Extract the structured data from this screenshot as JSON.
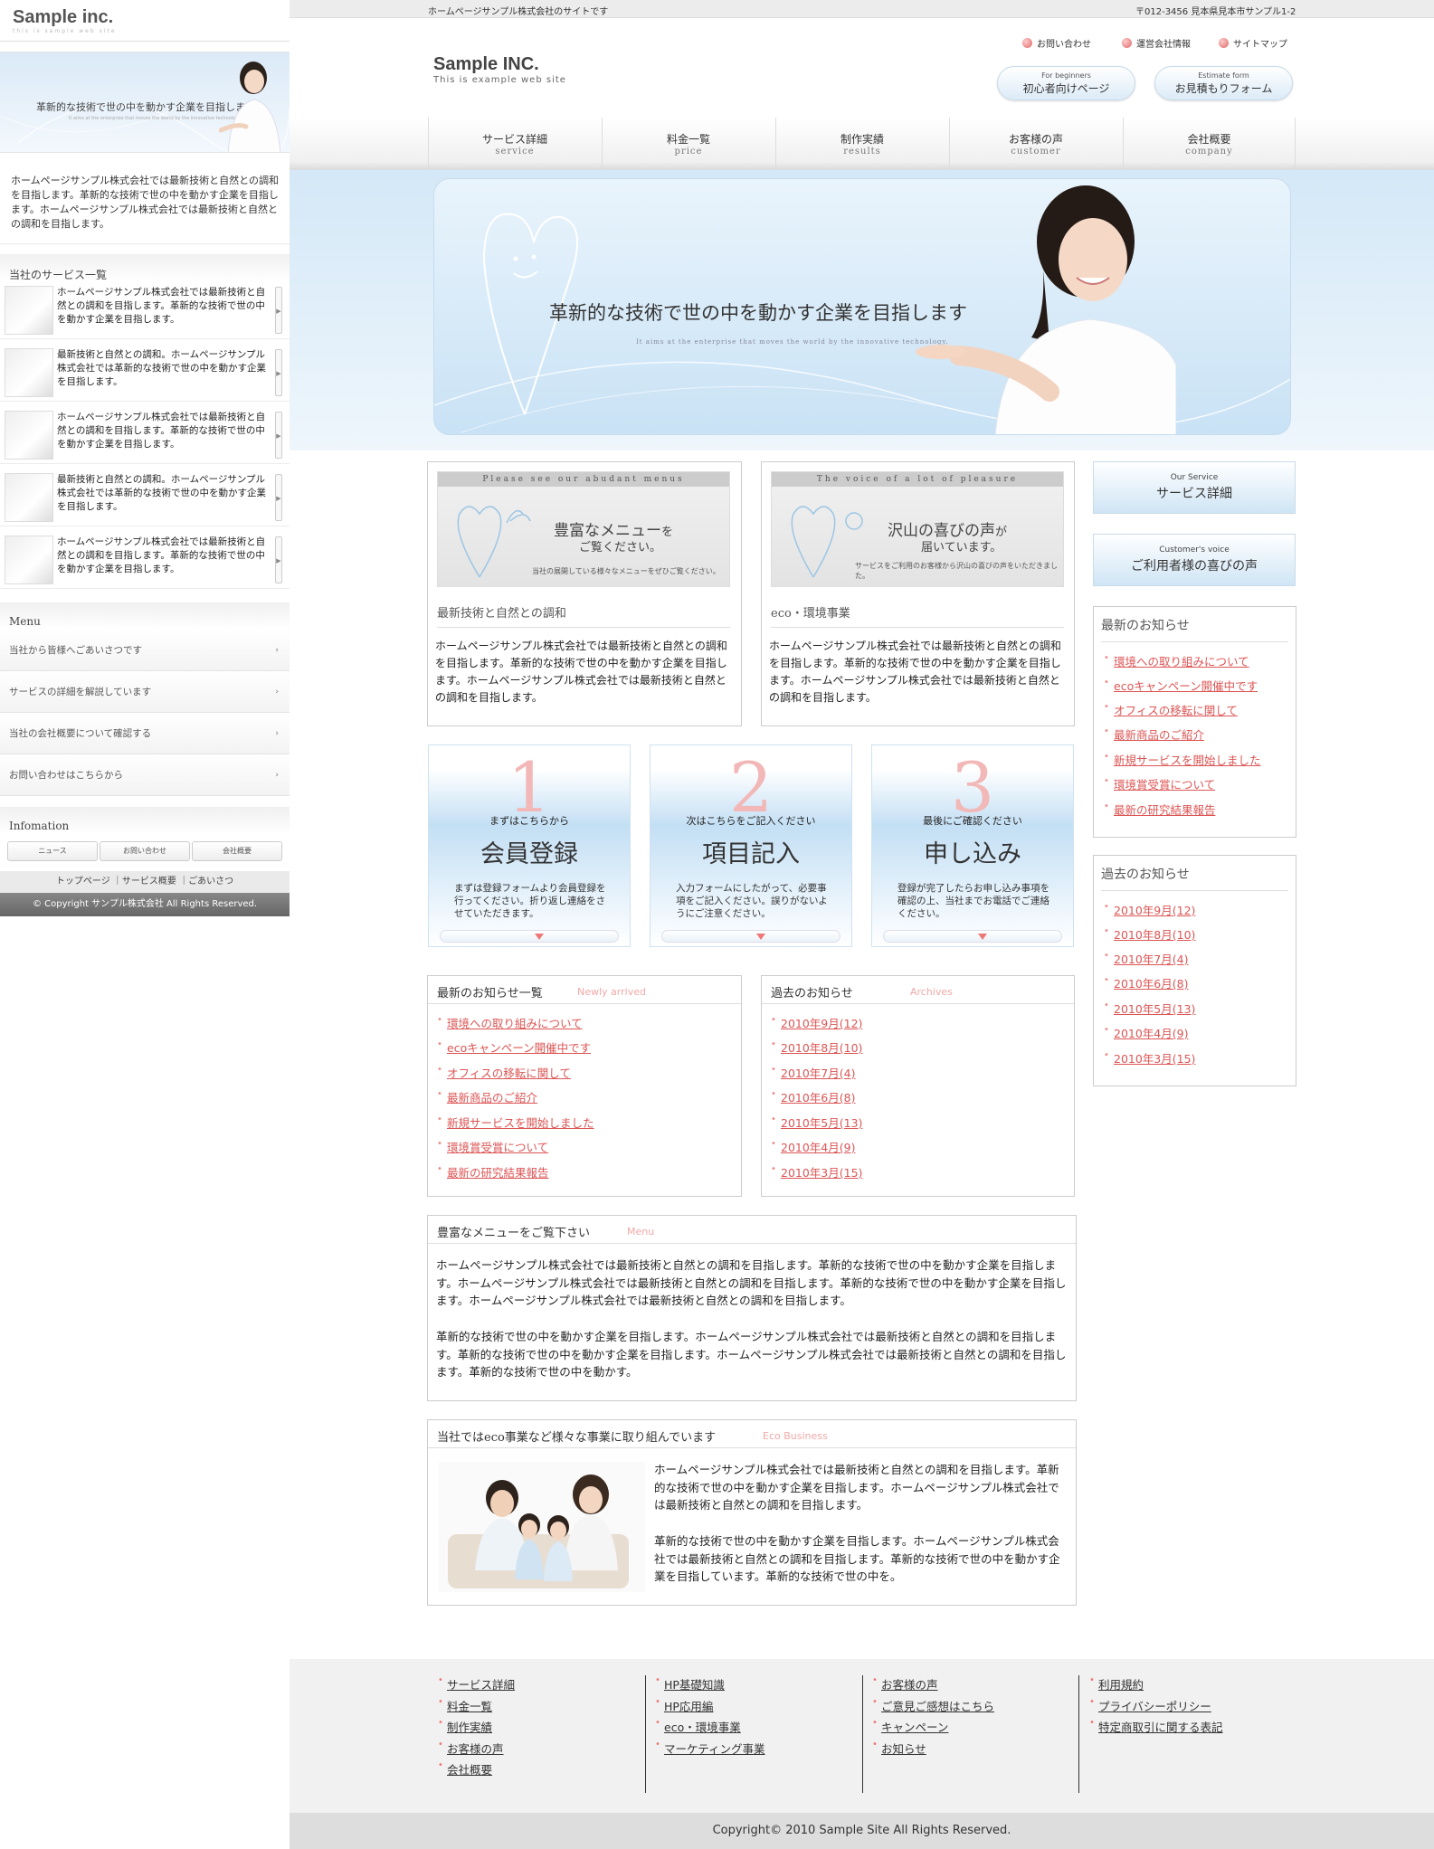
{
  "sidebar": {
    "logo": "Sample inc.",
    "logo_sub": "this is sample web site",
    "banner_text": "革新的な技術で世の中を動かす企業を目指します",
    "banner_sub": "It aims at the enterprise that moves the world by the innovative technology.",
    "intro": "ホームページサンプル株式会社では最新技術と自然との調和を目指します。革新的な技術で世の中を動かす企業を目指します。ホームページサンプル株式会社では最新技術と自然との調和を目指します。",
    "services_heading": "当社のサービス一覧",
    "services": [
      {
        "text": "ホームページサンプル株式会社では最新技術と自然との調和を目指します。革新的な技術で世の中を動かす企業を目指します。"
      },
      {
        "text": "最新技術と自然との調和。ホームページサンプル株式会社では革新的な技術で世の中を動かす企業を目指します。"
      },
      {
        "text": "ホームページサンプル株式会社では最新技術と自然との調和を目指します。革新的な技術で世の中を動かす企業を目指します。"
      },
      {
        "text": "最新技術と自然との調和。ホームページサンプル株式会社では革新的な技術で世の中を動かす企業を目指します。"
      },
      {
        "text": "ホームページサンプル株式会社では最新技術と自然との調和を目指します。革新的な技術で世の中を動かす企業を目指します。"
      }
    ],
    "menu_heading": "Menu",
    "menu": [
      "当社から皆様へごあいさつです",
      "サービスの詳細を解説しています",
      "当社の会社概要について確認する",
      "お問い合わせはこちらから"
    ],
    "info_heading": "Infomation",
    "info_buttons": [
      "ニュース",
      "お問い合わせ",
      "会社概要"
    ],
    "footer_links": "トップページ ｜サービス概要 ｜ごあいさつ",
    "copyright": "© Copyright サンプル株式会社 All Rights Reserved."
  },
  "topbar": {
    "tagline": "ホームページサンプル株式会社のサイトです",
    "address": "〒012-3456 見本県見本市サンプル1-2"
  },
  "header": {
    "logo": "Sample INC.",
    "logo_sub": "This is example web site",
    "util_links": [
      "お問い合わせ",
      "運営会社情報",
      "サイトマップ"
    ],
    "pill1": {
      "small": "For beginners",
      "label": "初心者向けページ"
    },
    "pill2": {
      "small": "Estimate form",
      "label": "お見積もりフォーム"
    }
  },
  "nav": [
    {
      "ja": "サービス詳細",
      "en": "service"
    },
    {
      "ja": "料金一覧",
      "en": "price"
    },
    {
      "ja": "制作実績",
      "en": "results"
    },
    {
      "ja": "お客様の声",
      "en": "customer"
    },
    {
      "ja": "会社概要",
      "en": "company"
    }
  ],
  "hero": {
    "headline": "革新的な技術で世の中を動かす企業を目指します",
    "sub": "It aims at the enterprise that moves the world by the innovative technology."
  },
  "features": [
    {
      "caption": "Please see our abudant menus",
      "big1": "豊富なメニュー",
      "big1s": "を",
      "big2": "ご覧ください。",
      "small": "当社の展開している様々なメニューをぜひご覧ください。",
      "title": "最新技術と自然との調和",
      "body": "ホームページサンプル株式会社では最新技術と自然との調和を目指します。革新的な技術で世の中を動かす企業を目指します。ホームページサンプル株式会社では最新技術と自然との調和を目指します。"
    },
    {
      "caption": "The voice of a lot of pleasure",
      "big1": "沢山の喜びの声",
      "big1s": "が",
      "big2": "届いています。",
      "small": "サービスをご利用のお客様から沢山の喜びの声をいただきました。",
      "title": "eco・環境事業",
      "body": "ホームページサンプル株式会社では最新技術と自然との調和を目指します。革新的な技術で世の中を動かす企業を目指します。ホームページサンプル株式会社では最新技術と自然との調和を目指します。"
    }
  ],
  "side_buttons": [
    {
      "small": "Our Service",
      "label": "サービス詳細"
    },
    {
      "small": "Customer's voice",
      "label": "ご利用者様の喜びの声"
    }
  ],
  "side_news_title": "最新のお知らせ",
  "side_archive_title": "過去のお知らせ",
  "news": [
    "環境への取り組みについて",
    "ecoキャンペーン開催中です",
    "オフィスの移転に関して",
    "最新商品のご紹介",
    "新規サービスを開始しました",
    "環境賞受賞について",
    "最新の研究結果報告"
  ],
  "archives": [
    "2010年9月(12)",
    "2010年8月(10)",
    "2010年7月(4)",
    "2010年6月(8)",
    "2010年5月(13)",
    "2010年4月(9)",
    "2010年3月(15)"
  ],
  "steps": [
    {
      "num": "1",
      "label": "まずはこちらから",
      "title": "会員登録",
      "desc": "まずは登録フォームより会員登録を行ってください。折り返し連絡をさせていただきます。"
    },
    {
      "num": "2",
      "label": "次はこちらをご記入ください",
      "title": "項目記入",
      "desc": "入力フォームにしたがって、必要事項をご記入ください。誤りがないようにご注意ください。"
    },
    {
      "num": "3",
      "label": "最後にご確認ください",
      "title": "申し込み",
      "desc": "登録が完了したらお申し込み事項を確認の上、当社までお電話でご連絡ください。"
    }
  ],
  "news_box": {
    "title": "最新のお知らせ一覧",
    "sub": "Newly arrived"
  },
  "archive_box": {
    "title": "過去のお知らせ",
    "sub": "Archives"
  },
  "menu_box": {
    "title": "豊富なメニューをご覧下さい",
    "sub": "Menu",
    "p1": "ホームページサンプル株式会社では最新技術と自然との調和を目指します。革新的な技術で世の中を動かす企業を目指します。ホームページサンプル株式会社では最新技術と自然との調和を目指します。革新的な技術で世の中を動かす企業を目指します。ホームページサンプル株式会社では最新技術と自然との調和を目指します。",
    "p2": "革新的な技術で世の中を動かす企業を目指します。ホームページサンプル株式会社では最新技術と自然との調和を目指します。革新的な技術で世の中を動かす企業を目指します。ホームページサンプル株式会社では最新技術と自然との調和を目指します。革新的な技術で世の中を動かす。"
  },
  "eco_box": {
    "title": "当社ではeco事業など様々な事業に取り組んでいます",
    "sub": "Eco Business",
    "p1": "ホームページサンプル株式会社では最新技術と自然との調和を目指します。革新的な技術で世の中を動かす企業を目指します。ホームページサンプル株式会社では最新技術と自然との調和を目指します。",
    "p2": "革新的な技術で世の中を動かす企業を目指します。ホームページサンプル株式会社では最新技術と自然との調和を目指します。革新的な技術で世の中を動かす企業を目指しています。革新的な技術で世の中を。"
  },
  "footer": {
    "col1": [
      "サービス詳細",
      "料金一覧",
      "制作実績",
      "お客様の声",
      "会社概要"
    ],
    "col2": [
      "HP基礎知識",
      "HP応用編",
      "eco・環境事業",
      "マーケティング事業"
    ],
    "col3": [
      "お客様の声",
      "ご意見ご感想はこちら",
      "キャンペーン",
      "お知らせ"
    ],
    "col4": [
      "利用規約",
      "プライバシーポリシー",
      "特定商取引に関する表記"
    ],
    "copyright": "Copyright© 2010 Sample Site All Rights Reserved."
  }
}
